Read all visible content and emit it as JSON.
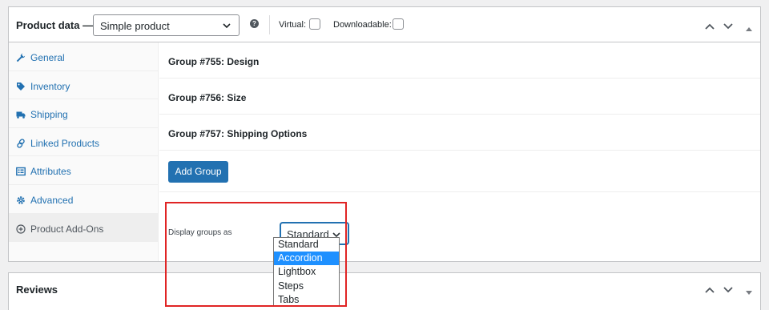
{
  "product_data": {
    "title": "Product data —",
    "product_type": "Simple product",
    "help_icon": "help-icon",
    "virtual_label": "Virtual:",
    "downloadable_label": "Downloadable:"
  },
  "sidebar": {
    "items": [
      {
        "label": "General",
        "icon": "wrench-icon"
      },
      {
        "label": "Inventory",
        "icon": "tag-icon"
      },
      {
        "label": "Shipping",
        "icon": "truck-icon"
      },
      {
        "label": "Linked Products",
        "icon": "link-icon"
      },
      {
        "label": "Attributes",
        "icon": "list-icon"
      },
      {
        "label": "Advanced",
        "icon": "gear-icon"
      },
      {
        "label": "Product Add-Ons",
        "icon": "plus-circle-icon"
      }
    ]
  },
  "groups": [
    {
      "label": "Group #755: Design"
    },
    {
      "label": "Group #756: Size"
    },
    {
      "label": "Group #757: Shipping Options"
    }
  ],
  "add_group_label": "Add Group",
  "display_groups": {
    "label": "Display groups as",
    "selected": "Standard",
    "options": [
      "Standard",
      "Accordion",
      "Lightbox",
      "Steps",
      "Tabs"
    ],
    "highlighted_option": "Accordion"
  },
  "reviews": {
    "title": "Reviews"
  },
  "colors": {
    "accent": "#2271b1",
    "highlight_box": "#e02424",
    "option_highlight": "#1e90ff"
  }
}
